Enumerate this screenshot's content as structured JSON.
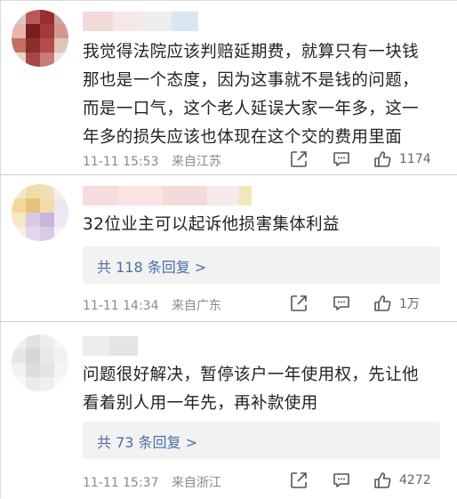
{
  "comments": [
    {
      "text_lines": [
        "我觉得法院应该判赔延期费，就算只有一块钱",
        "那也是一个态度，因为这事就不是钱的问题，",
        "而是一口气，这个老人延误大家一年多，这一",
        "年多的损失应该也体现在这个交的费用里面"
      ],
      "time": "11-11 15:53",
      "location": "来自江苏",
      "like_count": "1174"
    },
    {
      "text_lines": [
        "32位业主可以起诉他损害集体利益"
      ],
      "reply_summary": "共 118 条回复 >",
      "time": "11-11 14:34",
      "location": "来自广东",
      "like_count": "1万"
    },
    {
      "text_lines": [
        "问题很好解决，暂停该户一年使用权，先让他",
        "看着别人用一年先，再补款使用"
      ],
      "reply_summary": "共 73 条回复 >",
      "time": "11-11 15:37",
      "location": "来自浙江",
      "like_count": "4272"
    }
  ],
  "icons": [
    "share-icon",
    "comment-icon",
    "like-icon"
  ],
  "colors": {
    "link": "#4a6fa5",
    "meta": "#8a8a8a",
    "reply_bg": "#f2f2f2"
  }
}
